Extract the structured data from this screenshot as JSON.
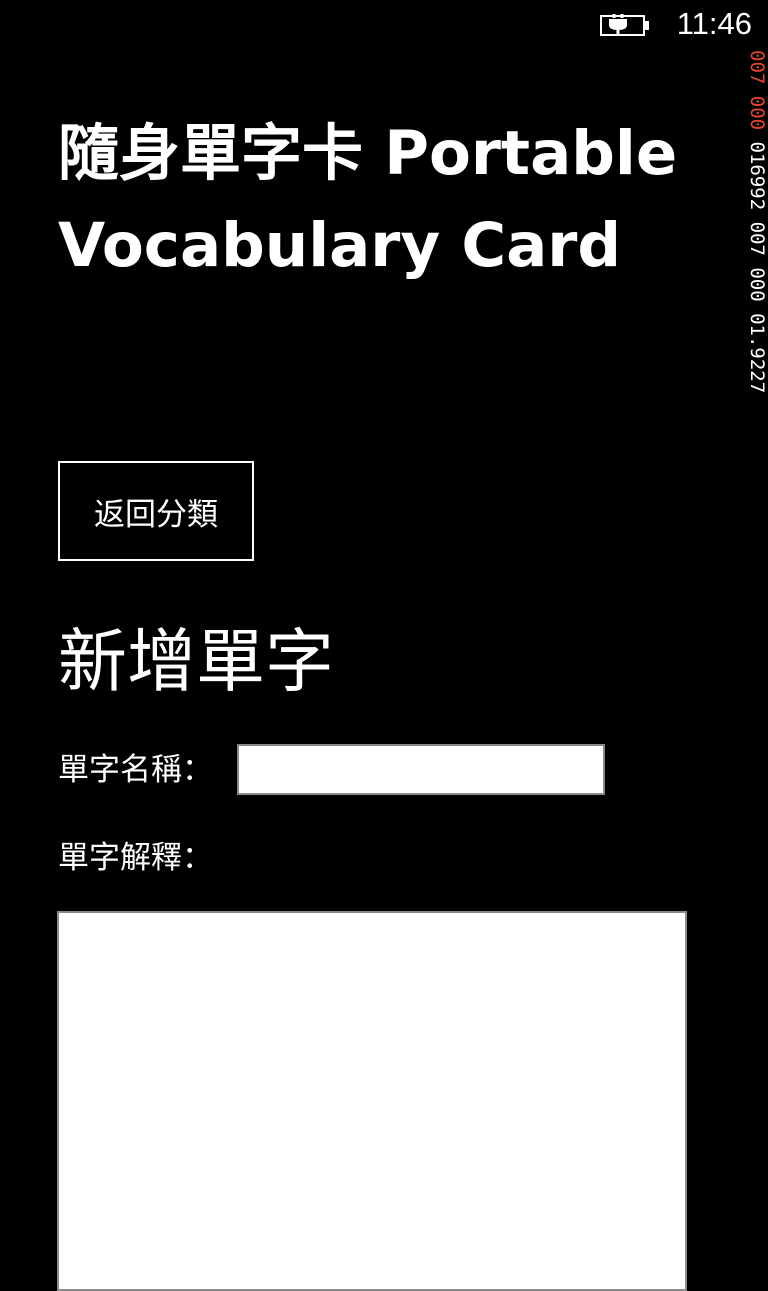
{
  "status_bar": {
    "time": "11:46",
    "battery_icon": "battery-charging-icon"
  },
  "perf_counter": {
    "segments": [
      {
        "text": "007 000 ",
        "color": "#e2462d"
      },
      {
        "text": "016992 007 000 01.9227",
        "color": "#ffffff"
      }
    ]
  },
  "header": {
    "app_title": "隨身單字卡 Portable Vocabulary Card",
    "back_button_label": "返回分類"
  },
  "form": {
    "section_title": "新增單字",
    "word_label": "單字名稱：",
    "word_value": "",
    "definition_label": "單字解釋：",
    "definition_value": ""
  }
}
